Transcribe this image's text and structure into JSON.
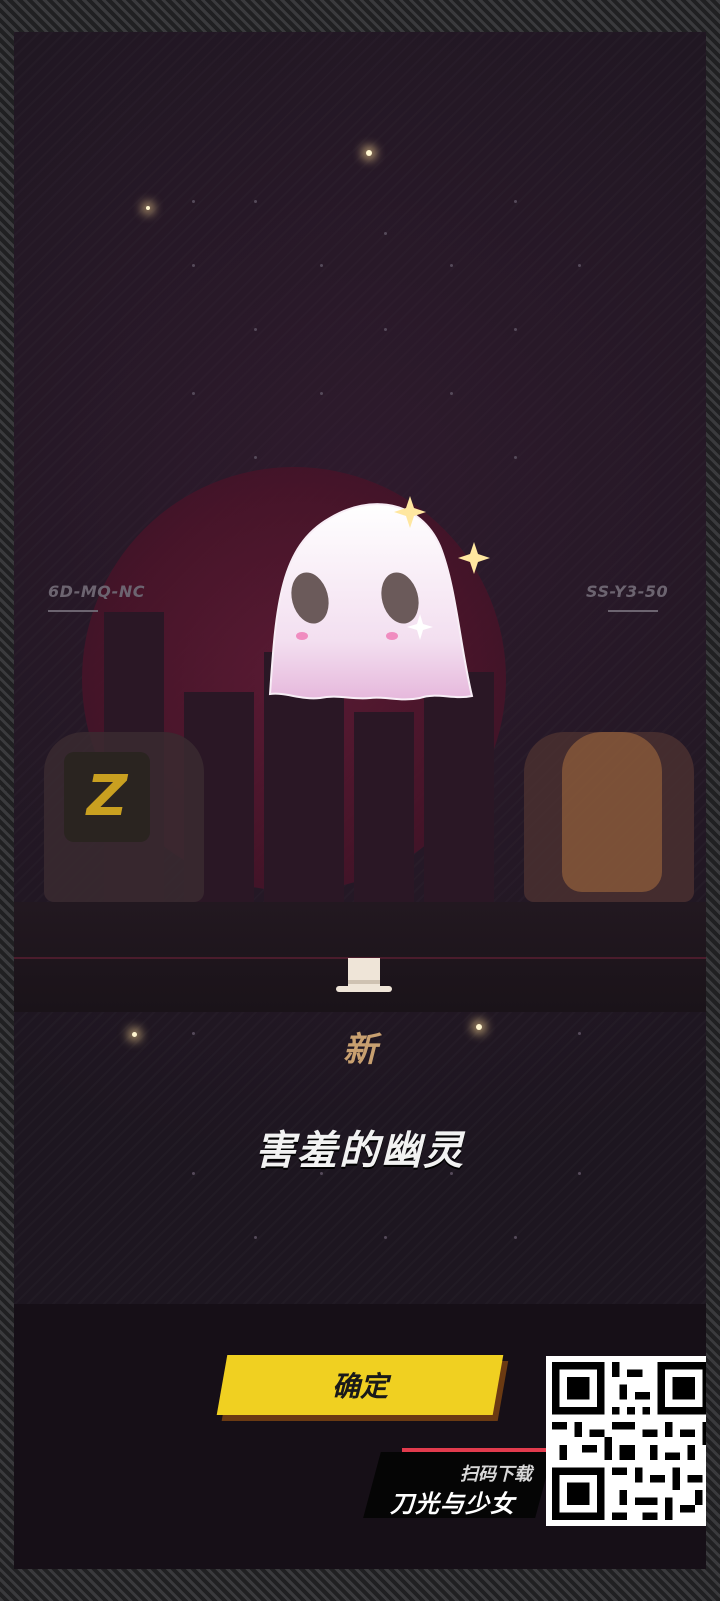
{
  "left_code": "6D-MQ-NC",
  "right_code": "SS-Y3-50",
  "new_tag": "新",
  "item_name": "害羞的幽灵",
  "confirm_label": "确定",
  "promo": {
    "sub": "扫码下载",
    "title": "刀光与少女"
  },
  "colors": {
    "confirm_button": "#f0d021",
    "new_tag": "#c8a070",
    "promo_line": "#e23b4d"
  },
  "icons": [
    "ghost-icon",
    "top-hat-icon",
    "qr-code"
  ]
}
